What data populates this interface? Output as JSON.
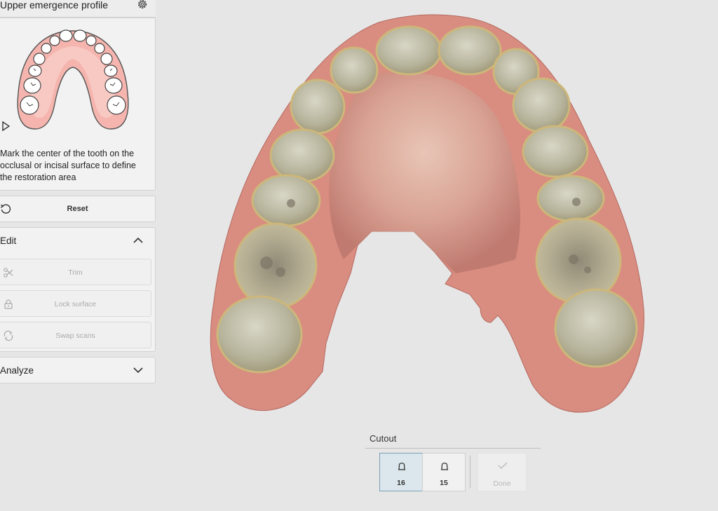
{
  "panel": {
    "title": "Upper emergence profile",
    "instruction": "Mark the center of the tooth on the occlusal or incisal surface to define the restoration area"
  },
  "reset": {
    "label": "Reset"
  },
  "edit": {
    "title": "Edit",
    "expanded": true,
    "tools": [
      {
        "label": "Trim",
        "icon": "scissors-icon",
        "enabled": false
      },
      {
        "label": "Lock surface",
        "icon": "lock-icon",
        "enabled": false
      },
      {
        "label": "Swap scans",
        "icon": "swap-icon",
        "enabled": false
      }
    ]
  },
  "analyze": {
    "title": "Analyze",
    "expanded": false
  },
  "cutout": {
    "title": "Cutout",
    "teeth": [
      {
        "number": "16",
        "selected": true
      },
      {
        "number": "15",
        "selected": false
      }
    ],
    "done_label": "Done",
    "done_enabled": false
  },
  "colors": {
    "accent_selected_bg": "#dbe7ec",
    "accent_selected_border": "#7aa0b4",
    "gum_pink": "#f4b6b0",
    "disabled_text": "#ababab"
  }
}
